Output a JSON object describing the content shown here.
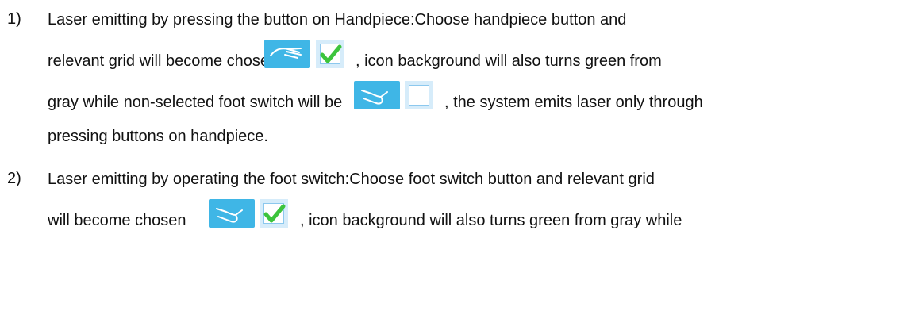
{
  "items": [
    {
      "number": "1)",
      "lines": [
        "Laser emitting by pressing the button on Handpiece:Choose handpiece button and",
        "relevant grid will become chosen",
        ", icon background will also turns green from",
        "gray while non-selected foot switch will be",
        ", the system emits laser only through",
        "pressing buttons on handpiece."
      ]
    },
    {
      "number": "2)",
      "lines": [
        "Laser emitting by operating the foot switch:Choose foot switch button and relevant grid",
        "will become chosen",
        ", icon background will also turns green from gray while"
      ]
    }
  ],
  "icons": {
    "handpiece": "hand-icon",
    "foot_switch": "foot-icon",
    "checked_grid": "checkmark-icon",
    "unchecked_grid": "empty-checkbox-icon",
    "button_color": "#3fb6e6",
    "grid_color": "#d6ecfa",
    "check_color": "#3cc43c"
  }
}
